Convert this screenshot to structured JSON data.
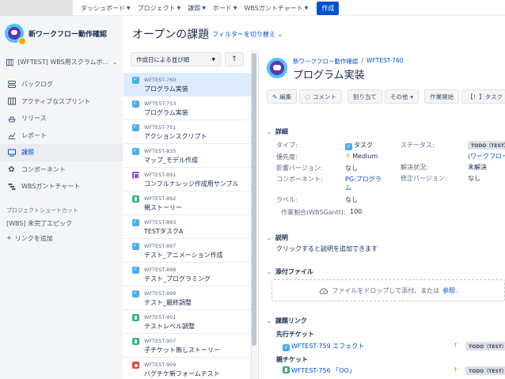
{
  "topnav": {
    "items": [
      "ダッシュボード",
      "プロジェクト",
      "課題",
      "ボード",
      "WBSガントチャート"
    ],
    "create_label": "作成"
  },
  "sidebar": {
    "project_name": "新ワークフロー動作確認",
    "board_selector": "[WFTEST] WBS用スクラムボ...",
    "items": [
      {
        "label": "バックログ",
        "icon": "backlog-icon"
      },
      {
        "label": "アクティブなスプリント",
        "icon": "sprint-board-icon"
      },
      {
        "label": "リリース",
        "icon": "ship-icon"
      },
      {
        "label": "レポート",
        "icon": "chart-icon"
      },
      {
        "label": "課題",
        "icon": "issues-icon",
        "active": true
      },
      {
        "label": "コンポーネント",
        "icon": "puzzle-icon"
      },
      {
        "label": "WBSガントチャート",
        "icon": "gantt-icon"
      }
    ],
    "shortcuts_header": "プロジェクトショートカット",
    "shortcut_link": "[WBS] 未完了エピック",
    "add_link": "リンクを追加"
  },
  "list": {
    "title": "オープンの課題",
    "filter_switch": "フィルターを切り替え",
    "sort_label": "作成日による並び順",
    "sort_direction": "↑",
    "issues": [
      {
        "key": "WFTEST-760",
        "summary": "プログラム実装",
        "type": "task",
        "selected": true
      },
      {
        "key": "WFTEST-753",
        "summary": "プログラム実装",
        "type": "task"
      },
      {
        "key": "WFTEST-751",
        "summary": "アクションスクリプト",
        "type": "task"
      },
      {
        "key": "WFTEST-835",
        "summary": "マップ_モデル作成",
        "type": "task"
      },
      {
        "key": "WFTEST-891",
        "summary": "コンフルナレッジ作成用サンプル",
        "type": "sub"
      },
      {
        "key": "WFTEST-892",
        "summary": "親ストーリー",
        "type": "story"
      },
      {
        "key": "WFTEST-893",
        "summary": "TESTタスクA",
        "type": "task"
      },
      {
        "key": "WFTEST-897",
        "summary": "テスト_アニメーション作成",
        "type": "task"
      },
      {
        "key": "WFTEST-898",
        "summary": "テスト_プログラミング",
        "type": "task"
      },
      {
        "key": "WFTEST-899",
        "summary": "テスト_最終調整",
        "type": "task"
      },
      {
        "key": "WFTEST-901",
        "summary": "テストレベル調整",
        "type": "story"
      },
      {
        "key": "WFTEST-907",
        "summary": "子チケット無しストーリー",
        "type": "story"
      },
      {
        "key": "WFTEST-909",
        "summary": "バグチケ新フォームテスト",
        "type": "bug"
      }
    ]
  },
  "detail": {
    "breadcrumb_project": "新ワークフロー動作確認",
    "breadcrumb_key": "WFTEST-760",
    "title": "プログラム実装",
    "actions": [
      "編集",
      "コメント",
      "割り当て",
      "その他",
      "作業開始",
      "【！】タスク"
    ],
    "details_header": "詳細",
    "fields": {
      "type_label": "タイプ:",
      "type_value": "タスク",
      "priority_label": "優先度:",
      "priority_value": "Medium",
      "affects_label": "影響バージョン:",
      "affects_value": "なし",
      "component_label": "コンポーネント:",
      "component_value_1": "PG:プログラ",
      "component_value_2": "ム",
      "labels_label": "ラベル:",
      "labels_value": "なし",
      "progress_label": "作業割合(WBSGantt):",
      "progress_value": "100",
      "status_label": "ステータス:",
      "status_value": "TODO（TEST）",
      "status_sub": "(ワークフロー",
      "resolution_label": "解決状況:",
      "resolution_value": "未解決",
      "fix_label": "修正バージョン:",
      "fix_value": "なし"
    },
    "description_header": "説明",
    "description_placeholder": "クリックすると説明を追加できます",
    "attachments_header": "添付ファイル",
    "dropzone_text": "ファイルをドロップして添付、または",
    "dropzone_link": "参照.",
    "links_header": "課題リンク",
    "link_group_1": "先行チケット",
    "link_1_text": "WFTEST-759 エフェクト",
    "link_1_status": "TODO（TEST）",
    "link_group_2": "親チケット",
    "link_2_text": "WFTEST-756 「OO」",
    "link_2_status": "TODO（TEST）"
  }
}
